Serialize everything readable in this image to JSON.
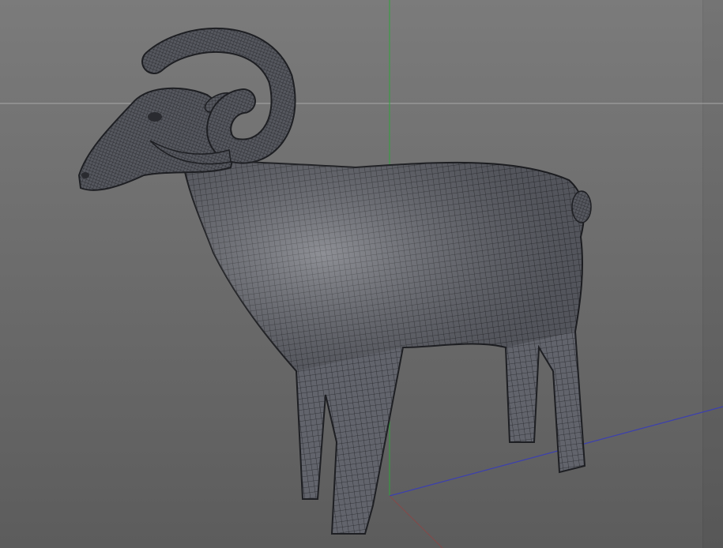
{
  "viewport": {
    "background_top": "#7b7b7b",
    "background_bottom": "#5c5c5c",
    "horizon_color": "#a8a8a8",
    "axis_y_color": "#2fa33a",
    "axis_z_color": "#3b3fb0",
    "axis_x_color": "#a03a3a",
    "mesh_color": "#60626a",
    "wire_color": "#2a2b30"
  },
  "scene": {
    "object": "ram-mesh",
    "display": "wireframe-shaded"
  }
}
